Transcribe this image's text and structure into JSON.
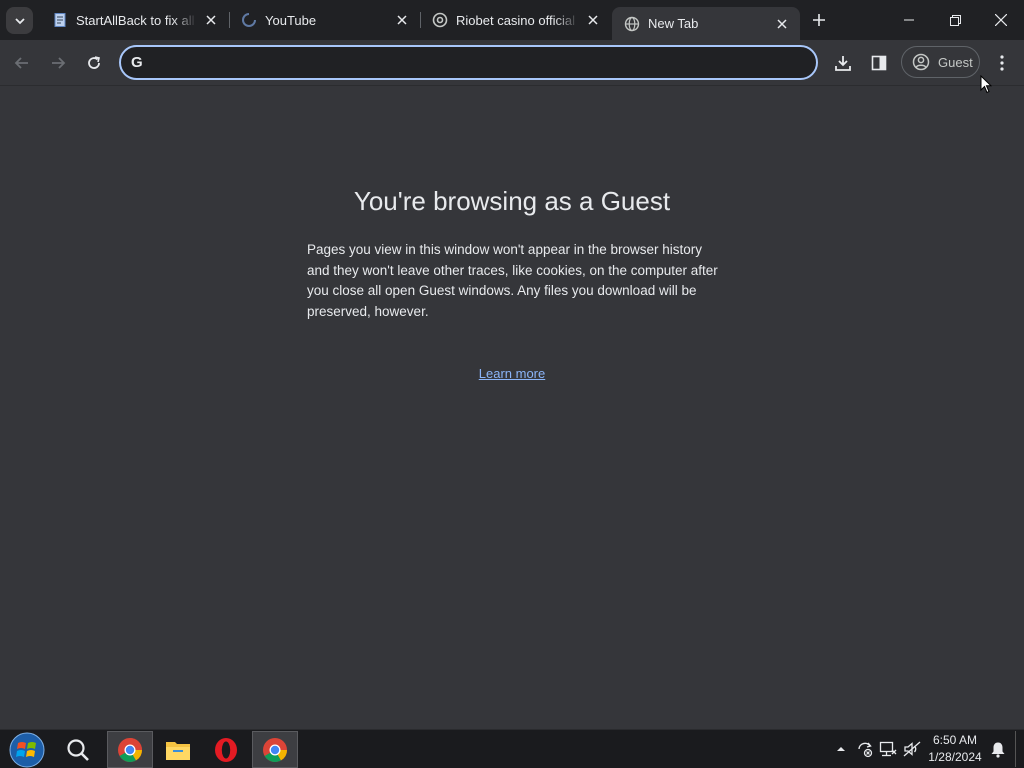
{
  "tabs": [
    {
      "title": "StartAllBack to fix all W",
      "favicon": "document-icon"
    },
    {
      "title": "YouTube",
      "favicon": "loading-spinner-icon"
    },
    {
      "title": "Riobet casino official -",
      "favicon": "riobet-icon"
    },
    {
      "title": "New Tab",
      "favicon": "globe-icon",
      "active": true
    }
  ],
  "omnibox": {
    "value": "",
    "search_provider": "G"
  },
  "profile": {
    "label": "Guest"
  },
  "content": {
    "heading": "You're browsing as a Guest",
    "description": "Pages you view in this window won't appear in the browser history and they won't leave other traces, like cookies, on the computer after you close all open Guest windows. Any files you download will be preserved, however.",
    "learn_more": "Learn more"
  },
  "taskbar": {
    "apps": [
      "start-orb",
      "search",
      "chrome",
      "file-explorer",
      "opera",
      "chrome"
    ],
    "clock": {
      "time": "6:50 AM",
      "date": "1/28/2024"
    }
  },
  "colors": {
    "tabstrip": "#202124",
    "toolbar": "#35363a",
    "omnibox_focus": "#a8c7fa",
    "link": "#8ab4f8",
    "text": "#e8eaed"
  }
}
